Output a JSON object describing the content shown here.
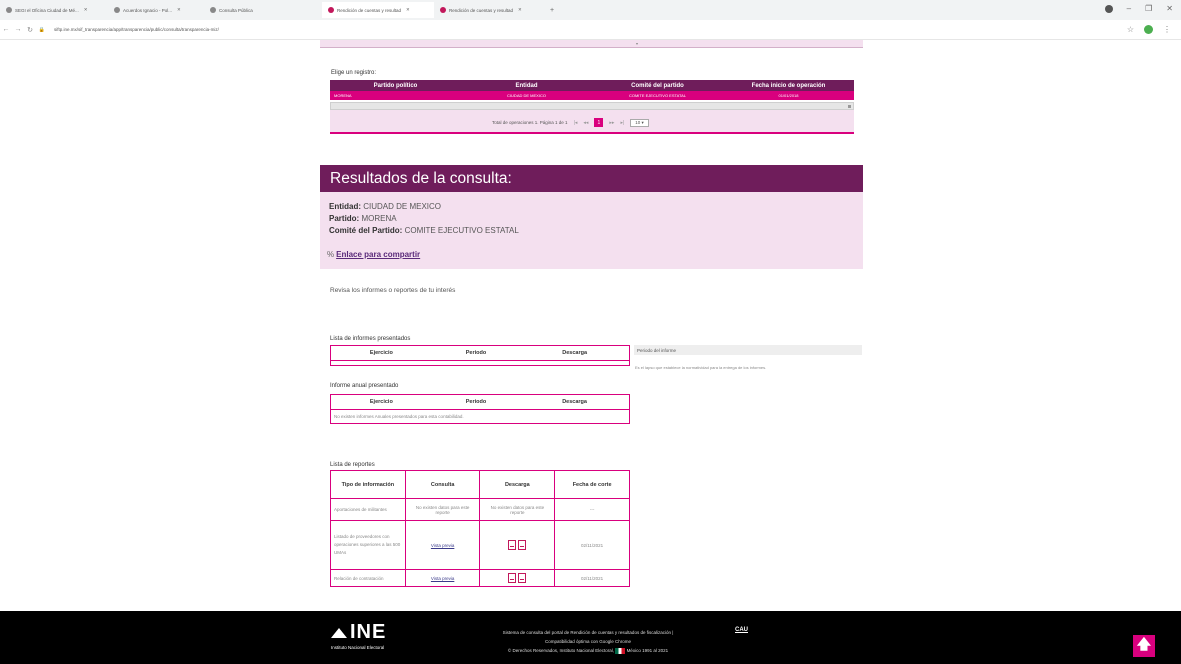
{
  "browser": {
    "tabs": [
      {
        "title": "SEGI el Oficina Ciudad de Mé...",
        "active": false,
        "pink": false
      },
      {
        "title": "Acuerdos Ignacio - Pol...",
        "active": false,
        "pink": false
      },
      {
        "title": "Consulta Pública",
        "active": false,
        "pink": false
      },
      {
        "title": "Rendición de cuentas y resultad",
        "active": true,
        "pink": true
      },
      {
        "title": "Rendición de cuentas y resultad",
        "active": false,
        "pink": true
      }
    ],
    "new_tab": "+",
    "url": "siftp.ine.mx/sif_transparencia/app/transparencia/public/consulta/transparencia-miz/"
  },
  "registro": {
    "label": "Elige un registro:",
    "headers": [
      "Partido político",
      "Entidad",
      "Comité del partido",
      "Fecha inicio de operación"
    ],
    "row": [
      "MORENA",
      "CIUDAD DE MEXICO",
      "COMITE EJECUTIVO ESTATAL",
      "01/01/2018"
    ],
    "pager_text": "Total de operaciones 1. Página 1 de 1",
    "pager_current": "1",
    "pager_size": "10"
  },
  "resultados": {
    "title": "Resultados de la consulta:",
    "entidad_label": "Entidad:",
    "entidad_value": "CIUDAD DE MEXICO",
    "partido_label": "Partido:",
    "partido_value": "MORENA",
    "comite_label": "Comité del Partido:",
    "comite_value": "COMITE EJECUTIVO ESTATAL",
    "link_text": "Enlace para compartir"
  },
  "revisa": "Revisa los informes o reportes de tu interés",
  "informes": {
    "title": "Lista de informes presentados",
    "headers": [
      "Ejercicio",
      "Periodo",
      "Descarga"
    ]
  },
  "side": {
    "head": "Periodo del informe",
    "text": "Es el lapso que establece la normatividad para la entrega de los informes."
  },
  "anual": {
    "title": "Informe anual presentado",
    "headers": [
      "Ejercicio",
      "Periodo",
      "Descarga"
    ],
    "empty": "No existen informes Anuales presentados para esta contabilidad."
  },
  "reportes": {
    "title": "Lista de reportes",
    "headers": [
      "Tipo de información",
      "Consulta",
      "Descarga",
      "Fecha de corte"
    ],
    "rows": [
      {
        "tipo": "Aportaciones de militantes",
        "consulta": "No existen datos para este reporte",
        "descarga": "No existen datos para este reporte",
        "fecha": "---"
      },
      {
        "tipo": "Listado de proveedores con operaciones superiores a las 500 UMAs",
        "consulta": "Vista previa",
        "descarga": "",
        "fecha": "02/11/2021"
      },
      {
        "tipo": "Relación de contratación",
        "consulta": "Vista previa",
        "descarga": "",
        "fecha": "02/11/2021"
      }
    ]
  },
  "footer": {
    "logo": "INE",
    "logo_sub": "Instituto Nacional Electoral",
    "line1": "Sistema de consulta del portal de Rendición de cuentas y resultados de fiscalización |",
    "line2": "Compatibilidad óptima con Google Chrome",
    "line3": "© Derechos Reservados, Instituto Nacional Electoral,",
    "line3b": "México 1991 al 2021",
    "cau": "CAU"
  },
  "colors": {
    "purple": "#6f1d5b",
    "magenta": "#d9007e",
    "light_pink": "#f4e0ef"
  }
}
